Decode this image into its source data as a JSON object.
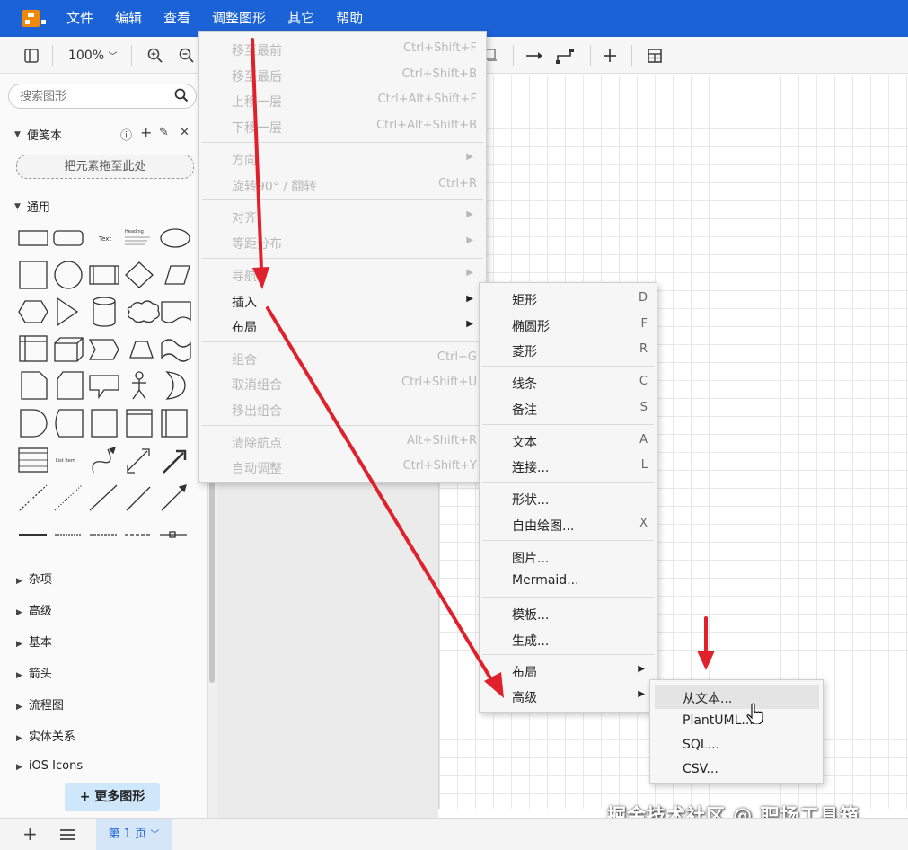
{
  "menubar": {
    "items": [
      "文件",
      "编辑",
      "查看",
      "调整图形",
      "其它",
      "帮助"
    ]
  },
  "toolbar": {
    "zoom": "100%"
  },
  "sidebar": {
    "search_placeholder": "搜索图形",
    "scratchpad": {
      "title": "便笺本",
      "drop_hint": "把元素拖至此处"
    },
    "general_title": "通用",
    "shape_labels": {
      "text": "Text",
      "heading": "Heading",
      "list_item": "List Item"
    },
    "categories": [
      "杂项",
      "高级",
      "基本",
      "箭头",
      "流程图",
      "实体关系",
      "iOS Icons"
    ],
    "more_shapes": "更多图形"
  },
  "arrange_menu": {
    "items": [
      {
        "label": "移至最前",
        "shortcut": "Ctrl+Shift+F"
      },
      {
        "label": "移至最后",
        "shortcut": "Ctrl+Shift+B"
      },
      {
        "label": "上移一层",
        "shortcut": "Ctrl+Alt+Shift+F"
      },
      {
        "label": "下移一层",
        "shortcut": "Ctrl+Alt+Shift+B"
      },
      {
        "label": "方向"
      },
      {
        "label": "旋转90° / 翻转",
        "shortcut": "Ctrl+R"
      },
      {
        "label": "对齐"
      },
      {
        "label": "等距分布"
      },
      {
        "label": "导航"
      },
      {
        "label": "插入"
      },
      {
        "label": "布局"
      },
      {
        "label": "组合",
        "shortcut": "Ctrl+G"
      },
      {
        "label": "取消组合",
        "shortcut": "Ctrl+Shift+U"
      },
      {
        "label": "移出组合"
      },
      {
        "label": "清除航点",
        "shortcut": "Alt+Shift+R"
      },
      {
        "label": "自动调整",
        "shortcut": "Ctrl+Shift+Y"
      }
    ]
  },
  "insert_menu": {
    "items": [
      {
        "label": "矩形",
        "shortcut": "D"
      },
      {
        "label": "椭圆形",
        "shortcut": "F"
      },
      {
        "label": "菱形",
        "shortcut": "R"
      },
      {
        "label": "线条",
        "shortcut": "C"
      },
      {
        "label": "备注",
        "shortcut": "S"
      },
      {
        "label": "文本",
        "shortcut": "A"
      },
      {
        "label": "连接...",
        "shortcut": "L"
      },
      {
        "label": "形状..."
      },
      {
        "label": "自由绘图...",
        "shortcut": "X"
      },
      {
        "label": "图片..."
      },
      {
        "label": "Mermaid..."
      },
      {
        "label": "模板..."
      },
      {
        "label": "生成..."
      },
      {
        "label": "布局"
      },
      {
        "label": "高级"
      }
    ]
  },
  "advanced_menu": {
    "items": [
      {
        "label": "从文本..."
      },
      {
        "label": "PlantUML..."
      },
      {
        "label": "SQL..."
      },
      {
        "label": "CSV..."
      }
    ]
  },
  "bottombar": {
    "page_tab": "第 1 页"
  },
  "watermark": "掘金技术社区 @ 职场工具箱",
  "colors": {
    "menubar": "#1a62d6",
    "annotation_arrow": "#e0202a",
    "page_tab_bg": "#d4e6f8"
  }
}
